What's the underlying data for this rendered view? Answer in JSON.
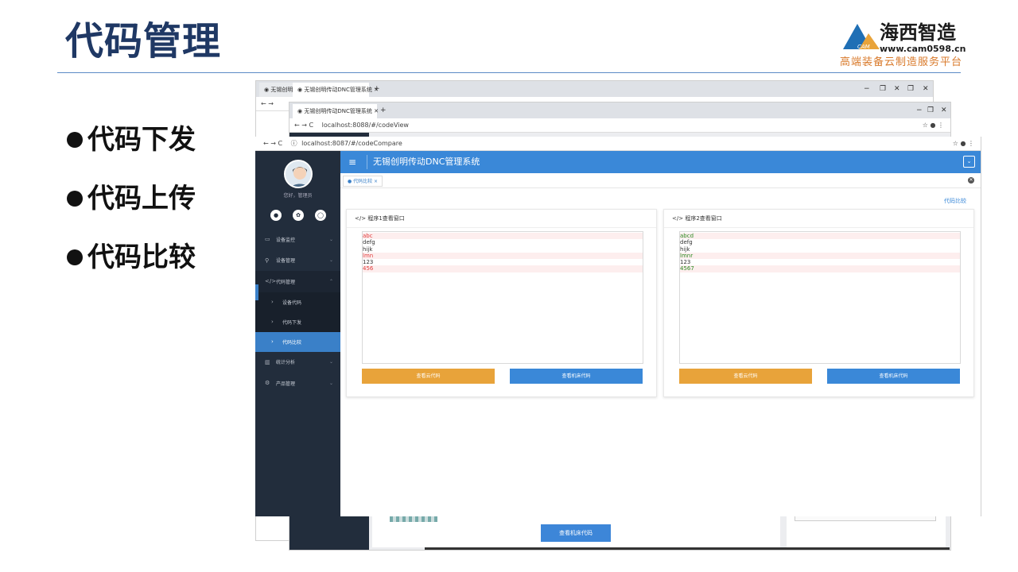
{
  "slide": {
    "title": "代码管理",
    "bullets": [
      "代码下发",
      "代码上传",
      "代码比较"
    ],
    "logo": {
      "brand": "海西智造",
      "url": "www.cam0598.cn",
      "tagline": "高端装备云制造服务平台",
      "mark": "CAM",
      "accent": "#1f6fb5",
      "accent2": "#e8a33a"
    }
  },
  "back_window_1": {
    "tabs": [
      "无锡创明...",
      "无锡创明传动DNC管理系统"
    ],
    "new_tab": "+",
    "controls": [
      "−",
      "❐",
      "✕",
      "❐",
      "✕"
    ]
  },
  "back_window_2": {
    "tab": "无锡创明传动DNC管理系统",
    "new_tab": "+",
    "url": "localhost:8088/#/codeView",
    "controls": [
      "−",
      "❐",
      "✕"
    ],
    "button_machine": "查看机床代码"
  },
  "front_window": {
    "url": "localhost:8087/#/codeCompare",
    "app_title": "无锡创明传动DNC管理系统",
    "greeting": "您好，管理员",
    "sidebar_menu": [
      {
        "label": "设备监控",
        "icon": "▭",
        "type": "top"
      },
      {
        "label": "设备管理",
        "icon": "⚲",
        "type": "top"
      },
      {
        "label": "代码管理",
        "icon": "</>",
        "type": "open"
      },
      {
        "label": "设备代码",
        "icon": "›",
        "type": "sub"
      },
      {
        "label": "代码下发",
        "icon": "›",
        "type": "sub"
      },
      {
        "label": "代码比较",
        "icon": "›",
        "type": "active"
      },
      {
        "label": "统计分析",
        "icon": "▥",
        "type": "top"
      },
      {
        "label": "产品管理",
        "icon": "⚙",
        "type": "top"
      }
    ],
    "page_tab": "● 代码比较 ×",
    "breadcrumb": "代码比较",
    "panel1": {
      "title": "程序1查看窗口",
      "lines": [
        {
          "text": "abc",
          "style": "red"
        },
        {
          "text": "defg",
          "style": "plain"
        },
        {
          "text": "hijk",
          "style": "plain"
        },
        {
          "text": "lmn",
          "style": "red"
        },
        {
          "text": "123",
          "style": "plain"
        },
        {
          "text": "456",
          "style": "red"
        }
      ],
      "btn_cloud": "查看云代码",
      "btn_machine": "查看机床代码"
    },
    "panel2": {
      "title": "程序2查看窗口",
      "lines": [
        {
          "text": "abcd",
          "style": "greenbg"
        },
        {
          "text": "defg",
          "style": "plain"
        },
        {
          "text": "hijk",
          "style": "plain"
        },
        {
          "text": "lmnr",
          "style": "greenbg"
        },
        {
          "text": "123",
          "style": "plain"
        },
        {
          "text": "4567",
          "style": "greenbg"
        }
      ],
      "btn_cloud": "查看云代码",
      "btn_machine": "查看机床代码"
    },
    "colors": {
      "sidebar": "#222d3c",
      "topbar": "#3a88d8",
      "active": "#3a80c8",
      "cloud_button": "#e8a33a",
      "diff_red": "#e03c3c",
      "diff_green": "#2c8a22"
    }
  }
}
